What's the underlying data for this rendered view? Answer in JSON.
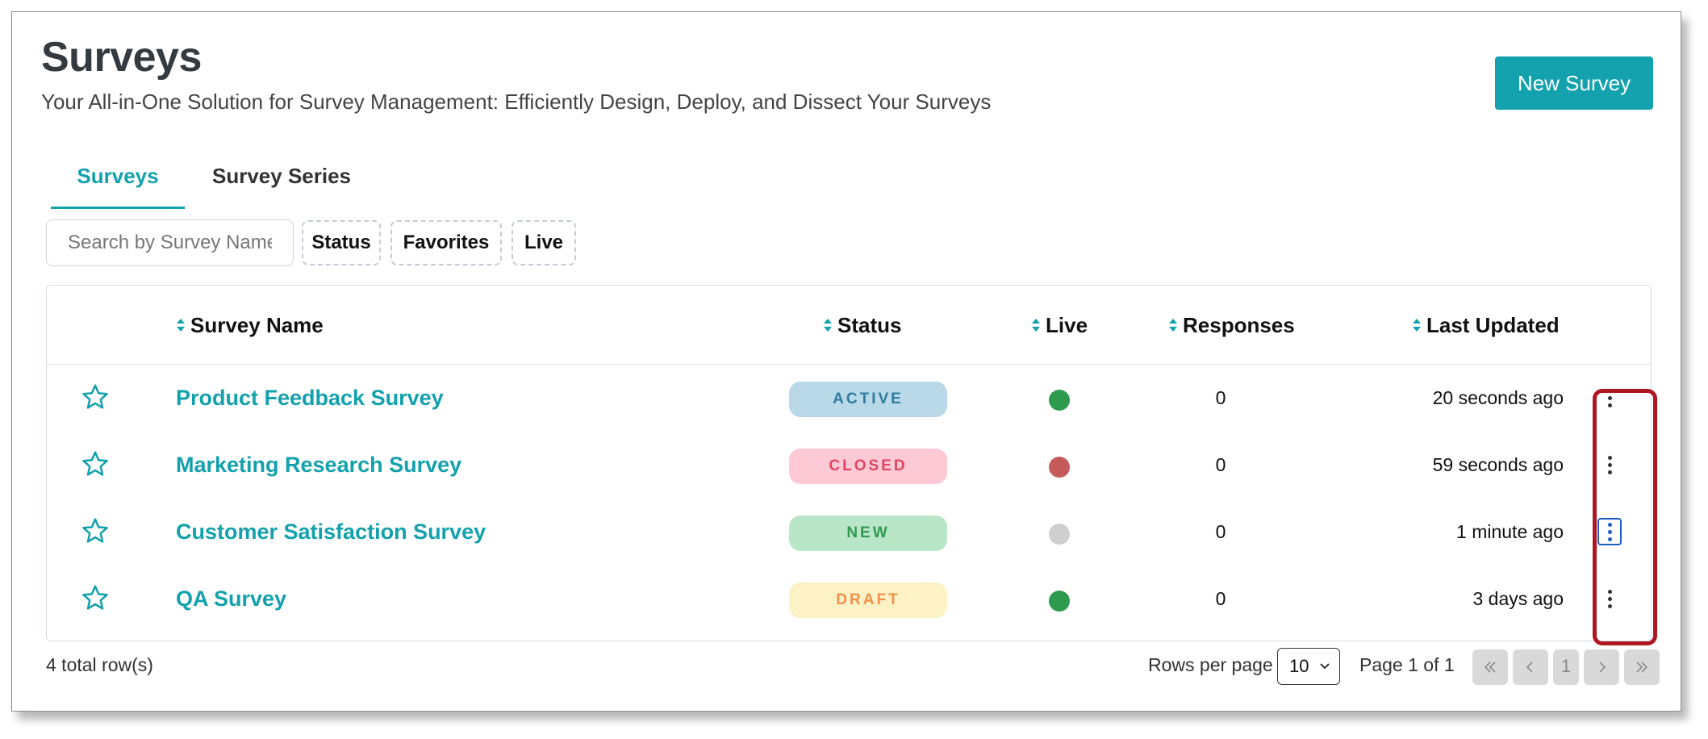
{
  "header": {
    "title": "Surveys",
    "subtitle": "Your All-in-One Solution for Survey Management: Efficiently Design, Deploy, and Dissect Your Surveys",
    "new_button": "New Survey"
  },
  "tabs": [
    {
      "label": "Surveys",
      "active": true
    },
    {
      "label": "Survey Series",
      "active": false
    }
  ],
  "filters": {
    "search_placeholder": "Search by Survey Name",
    "search_value": "",
    "buttons": [
      "Status",
      "Favorites",
      "Live"
    ]
  },
  "table": {
    "columns": [
      "Survey Name",
      "Status",
      "Live",
      "Responses",
      "Last Updated"
    ],
    "rows": [
      {
        "name": "Product Feedback Survey",
        "status": "ACTIVE",
        "live": "green",
        "responses": "0",
        "updated": "20 seconds ago"
      },
      {
        "name": "Marketing Research Survey",
        "status": "CLOSED",
        "live": "red",
        "responses": "0",
        "updated": "59 seconds ago"
      },
      {
        "name": "Customer Satisfaction Survey",
        "status": "NEW",
        "live": "gray",
        "responses": "0",
        "updated": "1 minute ago"
      },
      {
        "name": "QA Survey",
        "status": "DRAFT",
        "live": "green",
        "responses": "0",
        "updated": "3 days ago"
      }
    ]
  },
  "footer": {
    "total_rows": "4 total row(s)",
    "rows_per_page_label": "Rows per page",
    "rows_per_page_value": "10",
    "page_info": "Page 1 of 1",
    "current_page": "1"
  },
  "colors": {
    "accent": "#13a1ad",
    "active_bg": "#b9d9e8",
    "active_fg": "#2b7c9e",
    "closed_bg": "#fcc9d5",
    "closed_fg": "#e0455f",
    "new_bg": "#b8e6c6",
    "new_fg": "#2f9a50",
    "draft_bg": "#fdf1c6",
    "draft_fg": "#f2914a",
    "live_green": "#2e9a4d",
    "live_red": "#c45a5a",
    "live_gray": "#cfcfcf",
    "highlight": "#b01622"
  },
  "icons": {
    "star": "star-outline-icon",
    "sort": "sort-icon",
    "menu": "vertical-dots-icon",
    "pager": [
      "first-page-icon",
      "prev-page-icon",
      "next-page-icon",
      "last-page-icon"
    ]
  }
}
